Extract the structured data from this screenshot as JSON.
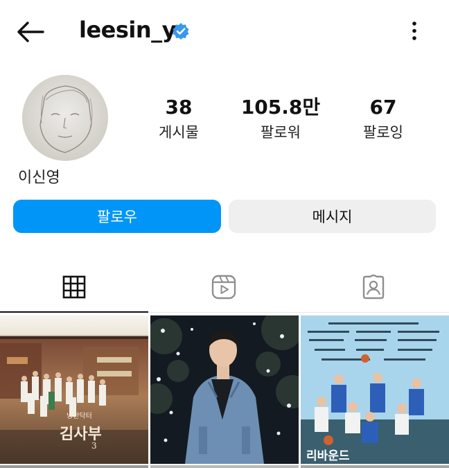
{
  "header": {
    "username": "leesin_y",
    "back_icon": "arrow-left-icon",
    "verified_icon": "verified-badge-icon",
    "more_icon": "more-vertical-icon"
  },
  "profile": {
    "display_name": "이신영",
    "stats": [
      {
        "value": "38",
        "label": "게시물"
      },
      {
        "value": "105.8만",
        "label": "팔로워"
      },
      {
        "value": "67",
        "label": "팔로잉"
      }
    ]
  },
  "actions": {
    "follow_label": "팔로우",
    "message_label": "메시지"
  },
  "tabs": [
    {
      "icon": "grid-icon",
      "selected": true
    },
    {
      "icon": "reels-icon",
      "selected": false
    },
    {
      "icon": "tagged-icon",
      "selected": false
    }
  ],
  "posts": [
    {
      "caption_text": "낭만닥터 김사부 3"
    },
    {
      "caption_text": ""
    },
    {
      "caption_text": "리바운드"
    }
  ],
  "colors": {
    "accent": "#0095f6",
    "verified": "#3897f0",
    "secondary_button": "#efefef"
  }
}
